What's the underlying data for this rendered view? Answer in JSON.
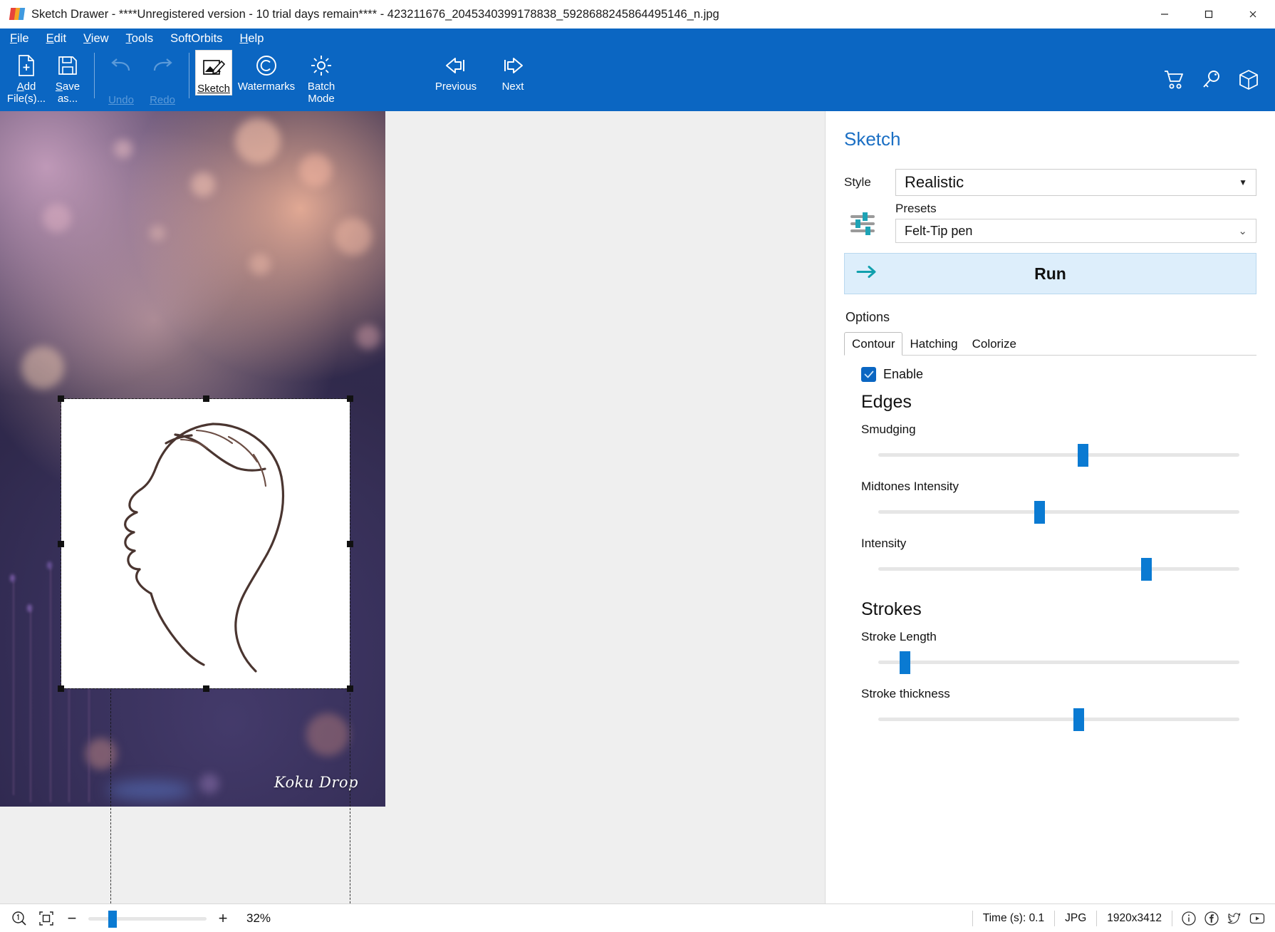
{
  "window": {
    "title": "Sketch Drawer - ****Unregistered version - 10 trial days remain**** - 423211676_2045340399178838_5928688245864495146_n.jpg",
    "minimize_label": "─",
    "maximize_label": "☐",
    "close_label": "✕"
  },
  "menu": [
    {
      "label": "File",
      "accel": "F"
    },
    {
      "label": "Edit",
      "accel": "E"
    },
    {
      "label": "View",
      "accel": "V"
    },
    {
      "label": "Tools",
      "accel": "T"
    },
    {
      "label": "SoftOrbits",
      "accel": ""
    },
    {
      "label": "Help",
      "accel": "H"
    }
  ],
  "toolbar": {
    "add_files": "Add\nFile(s)...",
    "add_files_line1": "Add",
    "add_files_line2": "File(s)...",
    "save_as_line1": "Save",
    "save_as_line2": "as...",
    "undo": "Undo",
    "redo": "Redo",
    "sketch": "Sketch",
    "watermarks": "Watermarks",
    "batch_line1": "Batch",
    "batch_line2": "Mode",
    "previous": "Previous",
    "next": "Next",
    "icons": {
      "add": "add-file-icon",
      "save": "save-icon",
      "undo": "undo-arrow-icon",
      "redo": "redo-arrow-icon",
      "sketch": "sketch-pencil-icon",
      "watermarks": "copyright-icon",
      "batch": "gear-icon",
      "previous": "arrow-left-icon",
      "next": "arrow-right-icon",
      "cart": "shopping-cart-icon",
      "key": "key-icon",
      "box": "package-box-icon"
    }
  },
  "panel": {
    "title": "Sketch",
    "style_label": "Style",
    "style_value": "Realistic",
    "presets_label": "Presets",
    "presets_value": "Felt-Tip pen",
    "run_label": "Run",
    "options_label": "Options",
    "tabs": [
      {
        "label": "Contour",
        "active": true
      },
      {
        "label": "Hatching",
        "active": false
      },
      {
        "label": "Colorize",
        "active": false
      }
    ],
    "enable_label": "Enable",
    "enable_checked": true,
    "groups": [
      {
        "title": "Edges",
        "sliders": [
          {
            "label": "Smudging",
            "percent": 56
          },
          {
            "label": "Midtones Intensity",
            "percent": 45
          },
          {
            "label": "Intensity",
            "percent": 72
          }
        ]
      },
      {
        "title": "Strokes",
        "sliders": [
          {
            "label": "Stroke Length",
            "percent": 11
          },
          {
            "label": "Stroke thickness",
            "percent": 55
          }
        ]
      }
    ],
    "accent_color": "#0a7ad2",
    "title_color": "#1b6fc4",
    "run_bg": "#ddeefb"
  },
  "canvas": {
    "watermark_signature": "Koku Drop"
  },
  "statusbar": {
    "zoom_1to1_icon": "zoom-actual-size-icon",
    "fit_icon": "fit-to-window-icon",
    "zoom_out": "−",
    "zoom_in": "+",
    "zoom_percent": "32%",
    "zoom_slider_percent": 17,
    "time": "Time (s): 0.1",
    "format": "JPG",
    "dimensions": "1920x3412",
    "social": [
      "info-icon",
      "facebook-icon",
      "twitter-icon",
      "youtube-icon"
    ]
  }
}
